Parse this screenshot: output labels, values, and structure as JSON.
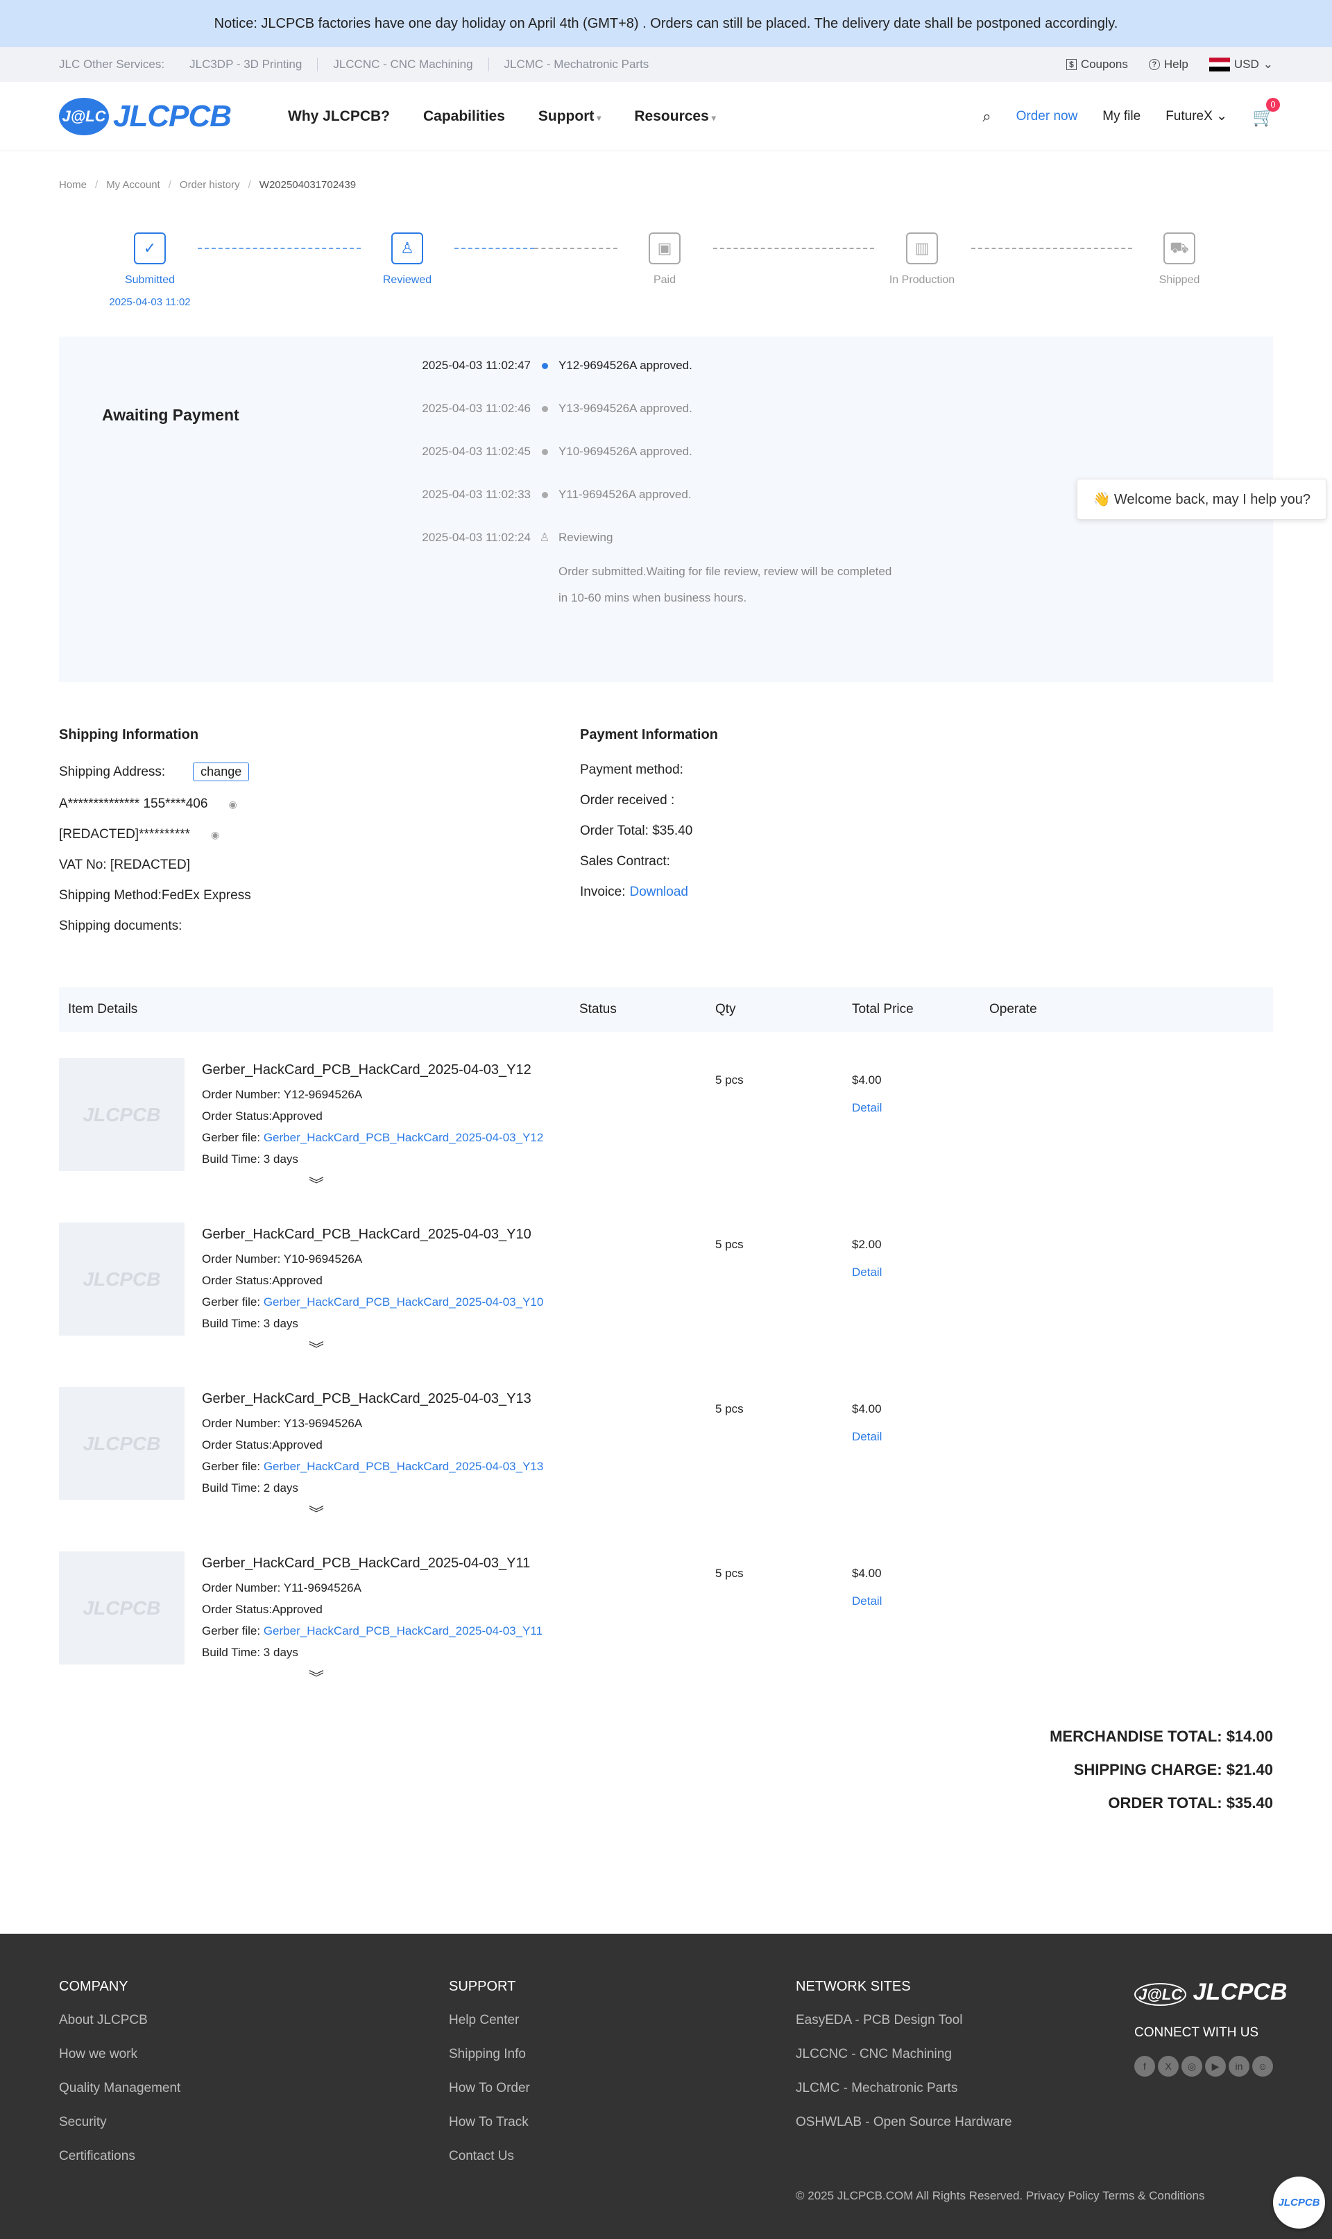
{
  "notice": "Notice: JLCPCB factories have one day holiday on April 4th (GMT+8) . Orders can still be placed. The delivery date shall be postponed accordingly.",
  "services": {
    "label": "JLC Other Services:",
    "items": [
      "JLC3DP - 3D Printing",
      "JLCCNC - CNC Machining",
      "JLCMC - Mechatronic Parts"
    ],
    "coupons": "Coupons",
    "help": "Help",
    "currency": "USD"
  },
  "header": {
    "logo_mark": "J@LC",
    "logo_word": "JLCPCB",
    "nav": [
      "Why JLCPCB?",
      "Capabilities",
      "Support",
      "Resources"
    ],
    "order_now": "Order now",
    "my_file": "My file",
    "user": "FutureX",
    "cart_count": "0"
  },
  "breadcrumb": [
    "Home",
    "My Account",
    "Order history",
    "W202504031702439"
  ],
  "steps": [
    {
      "label": "Submitted",
      "date": "2025-04-03 11:02",
      "icon": "clipboard-check-icon"
    },
    {
      "label": "Reviewed",
      "date": "",
      "icon": "stamp-icon"
    },
    {
      "label": "Paid",
      "date": "",
      "icon": "wallet-check-icon"
    },
    {
      "label": "In Production",
      "date": "",
      "icon": "factory-icon"
    },
    {
      "label": "Shipped",
      "date": "",
      "icon": "truck-icon"
    }
  ],
  "status": {
    "title": "Awaiting Payment",
    "log": [
      {
        "time": "2025-04-03 11:02:47",
        "msg": "Y12-9694526A approved."
      },
      {
        "time": "2025-04-03 11:02:46",
        "msg": "Y13-9694526A approved."
      },
      {
        "time": "2025-04-03 11:02:45",
        "msg": "Y10-9694526A approved."
      },
      {
        "time": "2025-04-03 11:02:33",
        "msg": "Y11-9694526A approved."
      },
      {
        "time": "2025-04-03 11:02:24",
        "msg": "Reviewing"
      }
    ],
    "sub_line1": "Order submitted.Waiting for file review, review will be completed",
    "sub_line2": "in 10-60 mins when business hours."
  },
  "chat_bubble": "👋 Welcome back, may I help you?",
  "shipping": {
    "title": "Shipping Information",
    "address_label": "Shipping Address:",
    "change": "change",
    "name_line": "A************** 155****406",
    "address_line": "[REDACTED]**********",
    "vat": "VAT No: [REDACTED]",
    "method": "Shipping Method:FedEx Express",
    "documents": "Shipping documents:"
  },
  "payment": {
    "title": "Payment Information",
    "method": "Payment method:",
    "received": "Order received :",
    "total": "Order Total: $35.40",
    "contract": "Sales Contract:",
    "invoice_label": "Invoice:",
    "invoice_link": "Download"
  },
  "table": {
    "headers": [
      "Item Details",
      "Status",
      "Qty",
      "Total Price",
      "Operate"
    ],
    "thumb_text": "JLCPCB",
    "rows": [
      {
        "name": "Gerber_HackCard_PCB_HackCard_2025-04-03_Y12",
        "order": "Order Number: Y12-9694526A",
        "status": "Order Status:Approved",
        "gerber_label": "Gerber file:",
        "gerber": "Gerber_HackCard_PCB_HackCard_2025-04-03_Y12",
        "build": "Build Time: 3 days",
        "qty": "5 pcs",
        "price": "$4.00",
        "detail": "Detail"
      },
      {
        "name": "Gerber_HackCard_PCB_HackCard_2025-04-03_Y10",
        "order": "Order Number: Y10-9694526A",
        "status": "Order Status:Approved",
        "gerber_label": "Gerber file:",
        "gerber": "Gerber_HackCard_PCB_HackCard_2025-04-03_Y10",
        "build": "Build Time: 3 days",
        "qty": "5 pcs",
        "price": "$2.00",
        "detail": "Detail"
      },
      {
        "name": "Gerber_HackCard_PCB_HackCard_2025-04-03_Y13",
        "order": "Order Number: Y13-9694526A",
        "status": "Order Status:Approved",
        "gerber_label": "Gerber file:",
        "gerber": "Gerber_HackCard_PCB_HackCard_2025-04-03_Y13",
        "build": "Build Time: 2 days",
        "qty": "5 pcs",
        "price": "$4.00",
        "detail": "Detail"
      },
      {
        "name": "Gerber_HackCard_PCB_HackCard_2025-04-03_Y11",
        "order": "Order Number: Y11-9694526A",
        "status": "Order Status:Approved",
        "gerber_label": "Gerber file:",
        "gerber": "Gerber_HackCard_PCB_HackCard_2025-04-03_Y11",
        "build": "Build Time: 3 days",
        "qty": "5 pcs",
        "price": "$4.00",
        "detail": "Detail"
      }
    ]
  },
  "totals": {
    "merchandise": "MERCHANDISE TOTAL: $14.00",
    "shipping": "SHIPPING CHARGE: $21.40",
    "order": "ORDER TOTAL: $35.40"
  },
  "footer": {
    "company": {
      "title": "COMPANY",
      "items": [
        "About JLCPCB",
        "How we work",
        "Quality Management",
        "Security",
        "Certifications"
      ]
    },
    "support": {
      "title": "SUPPORT",
      "items": [
        "Help Center",
        "Shipping Info",
        "How To Order",
        "How To Track",
        "Contact Us"
      ]
    },
    "network": {
      "title": "NETWORK SITES",
      "items": [
        "EasyEDA - PCB Design Tool",
        "JLCCNC - CNC Machining",
        "JLCMC - Mechatronic Parts",
        "OSHWLAB - Open Source Hardware"
      ]
    },
    "logo_mark": "J@LC",
    "logo_word": "JLCPCB",
    "connect": "CONNECT WITH US",
    "copyright": "© 2025 JLCPCB.COM All Rights Reserved. Privacy Policy Terms & Conditions",
    "fab_text": "JLCPCB"
  },
  "colors": {
    "accent": "#2c7be5",
    "notice_bg": "#cfe2fb",
    "footer_bg": "#333333",
    "badge": "#f5365c"
  }
}
